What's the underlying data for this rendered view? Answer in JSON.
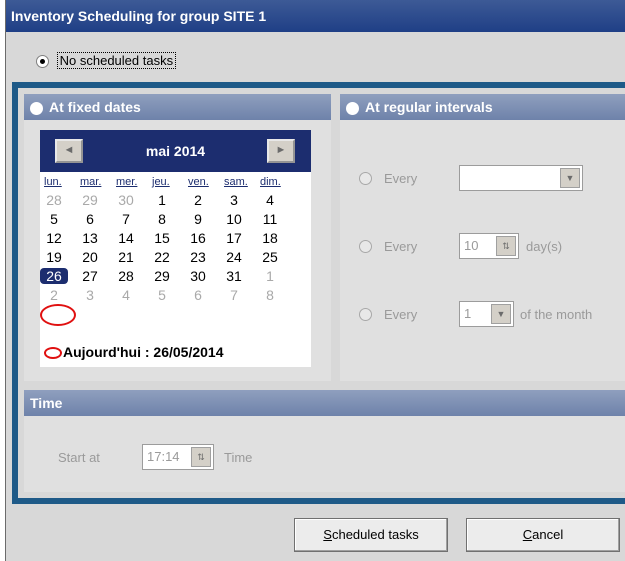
{
  "window": {
    "title": "Inventory Scheduling for group SITE 1"
  },
  "options": {
    "no_scheduled": "No scheduled tasks"
  },
  "fixed_dates": {
    "header": "At fixed dates",
    "calendar": {
      "month_title": "mai 2014",
      "prev_icon": "◄",
      "next_icon": "►",
      "weekdays": [
        "lun.",
        "mar.",
        "mer.",
        "jeu.",
        "ven.",
        "sam.",
        "dim."
      ],
      "weeks": [
        [
          "28",
          "29",
          "30",
          "1",
          "2",
          "3",
          "4"
        ],
        [
          "5",
          "6",
          "7",
          "8",
          "9",
          "10",
          "11"
        ],
        [
          "12",
          "13",
          "14",
          "15",
          "16",
          "17",
          "18"
        ],
        [
          "19",
          "20",
          "21",
          "22",
          "23",
          "24",
          "25"
        ],
        [
          "26",
          "27",
          "28",
          "29",
          "30",
          "31",
          "1"
        ],
        [
          "2",
          "3",
          "4",
          "5",
          "6",
          "7",
          "8"
        ]
      ],
      "today_label": "Aujourd'hui : 26/05/2014"
    }
  },
  "regular_intervals": {
    "header": "At regular intervals",
    "row1": {
      "label": "Every",
      "value": ""
    },
    "row2": {
      "label": "Every",
      "value": "10",
      "unit": "day(s)"
    },
    "row3": {
      "label": "Every",
      "value": "1",
      "unit": "of the month"
    }
  },
  "time": {
    "header": "Time",
    "start_label": "Start at",
    "start_value": "17:14",
    "unit": "Time"
  },
  "footer": {
    "scheduled_prefix": "S",
    "scheduled_rest": "cheduled tasks",
    "cancel_prefix": "C",
    "cancel_rest": "ancel"
  }
}
